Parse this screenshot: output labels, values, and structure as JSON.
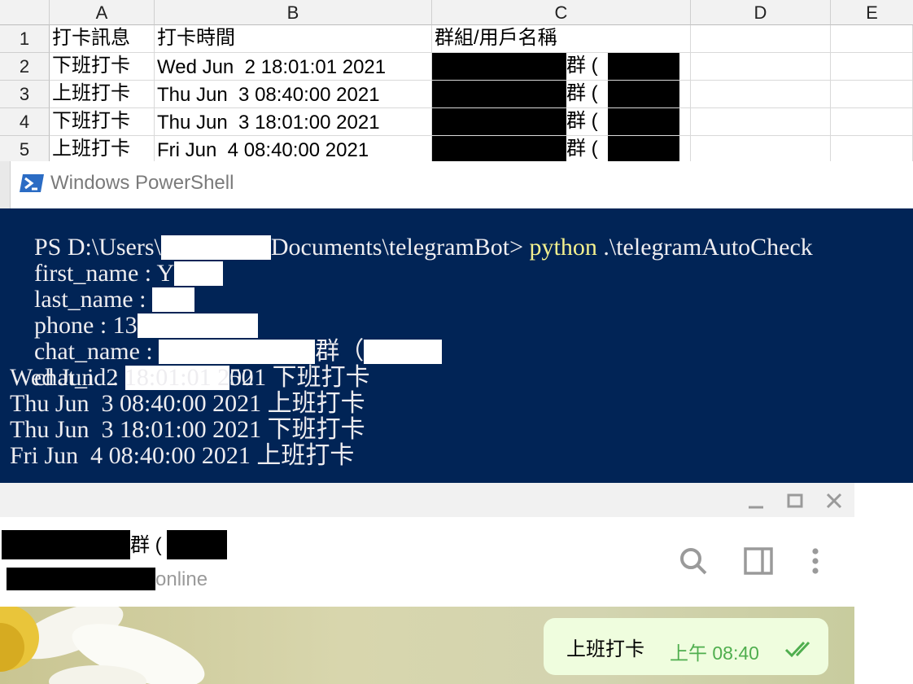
{
  "spreadsheet": {
    "columns": [
      "A",
      "B",
      "C",
      "D",
      "E"
    ],
    "header_row": {
      "num": "1",
      "a": "打卡訊息",
      "b": "打卡時間",
      "c": "群組/用戶名稱"
    },
    "rows": [
      {
        "num": "2",
        "a": "下班打卡",
        "b": "Wed Jun  2 18:01:01 2021",
        "c": "群 ("
      },
      {
        "num": "3",
        "a": "上班打卡",
        "b": "Thu Jun  3 08:40:00 2021",
        "c": "群 ("
      },
      {
        "num": "4",
        "a": "下班打卡",
        "b": "Thu Jun  3 18:01:00 2021",
        "c": "群 ("
      },
      {
        "num": "5",
        "a": "上班打卡",
        "b": "Fri Jun  4 08:40:00 2021",
        "c": "群 ("
      }
    ]
  },
  "powershell": {
    "title": "Windows PowerShell",
    "prompt_prefix": "PS D:\\Users\\",
    "prompt_path": "Documents\\telegramBot>",
    "command": "python",
    "command_arg": ".\\telegramAutoCheck",
    "first_name_label": "first_name : Y",
    "last_name_label": "last_name :",
    "phone_label": "phone : 13",
    "chat_name_label": "chat_name :",
    "chat_name_suffix": "群（",
    "chat_id_label": "chat_id :",
    "chat_id_suffix": "50",
    "log": [
      "Wed Jun  2 18:01:01 2021 下班打卡",
      "Thu Jun  3 08:40:00 2021 上班打卡",
      "Thu Jun  3 18:01:00 2021 下班打卡",
      "Fri Jun  4 08:40:00 2021 上班打卡"
    ]
  },
  "telegram": {
    "chat_title_suffix": "群 (",
    "status": "online",
    "message": {
      "text": "上班打卡",
      "time": "上午 08:40"
    },
    "colors": {
      "accent": "#4fae4e",
      "bubble": "#effdde",
      "icon": "#9a9a9a"
    }
  },
  "icons": {
    "minimize": "minimize-icon",
    "maximize": "maximize-icon",
    "close": "close-icon",
    "search": "search-icon",
    "sidebar": "sidebar-toggle-icon",
    "more": "more-vertical-icon",
    "read": "double-check-icon"
  },
  "colors": {
    "powershell_bg": "#012456",
    "powershell_text": "#eeedf0",
    "powershell_command": "#f3f08e"
  }
}
